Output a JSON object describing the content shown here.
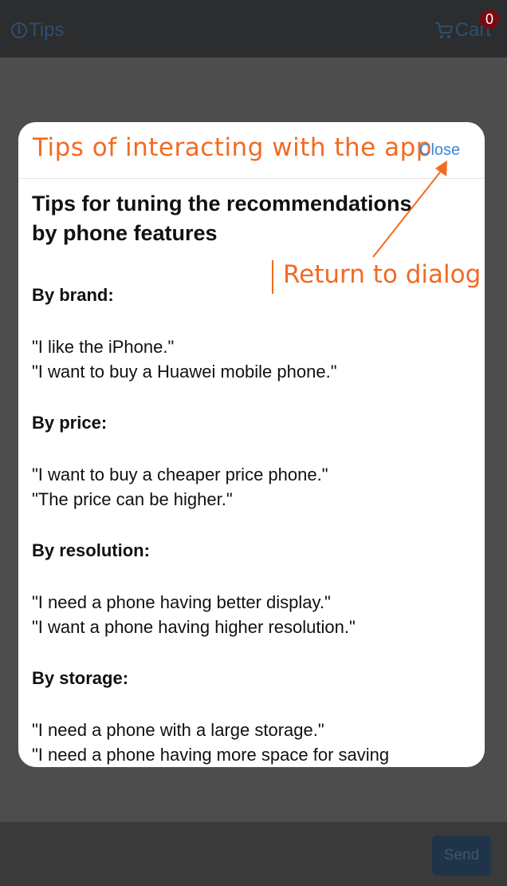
{
  "topbar": {
    "tips_label": "Tips",
    "cart_label": "Cart",
    "cart_count": "0"
  },
  "footer": {
    "send_label": "Send"
  },
  "modal": {
    "title": "Tips of interacting with the app",
    "close_label": "Close",
    "heading_line1": "Tips for tuning the recommendations",
    "heading_line2": "by phone features",
    "sections": [
      {
        "title": "By brand:",
        "examples": [
          "\"I like the iPhone.\"",
          "\"I want to buy a Huawei mobile phone.\""
        ]
      },
      {
        "title": "By price:",
        "examples": [
          "\"I want to buy a cheaper price phone.\"",
          "\"The price can be higher.\""
        ]
      },
      {
        "title": "By resolution:",
        "examples": [
          "\"I need a phone having better display.\"",
          "\"I want a phone having higher resolution.\""
        ]
      },
      {
        "title": "By storage:",
        "examples": [
          "\"I need a phone with a large storage.\"",
          "\"I need a phone having more space for saving"
        ]
      }
    ]
  },
  "annotation": {
    "text": "Return to dialog",
    "color": "#f26a22"
  },
  "icons": {
    "tips": "info-circle-icon",
    "cart": "cart-icon"
  }
}
